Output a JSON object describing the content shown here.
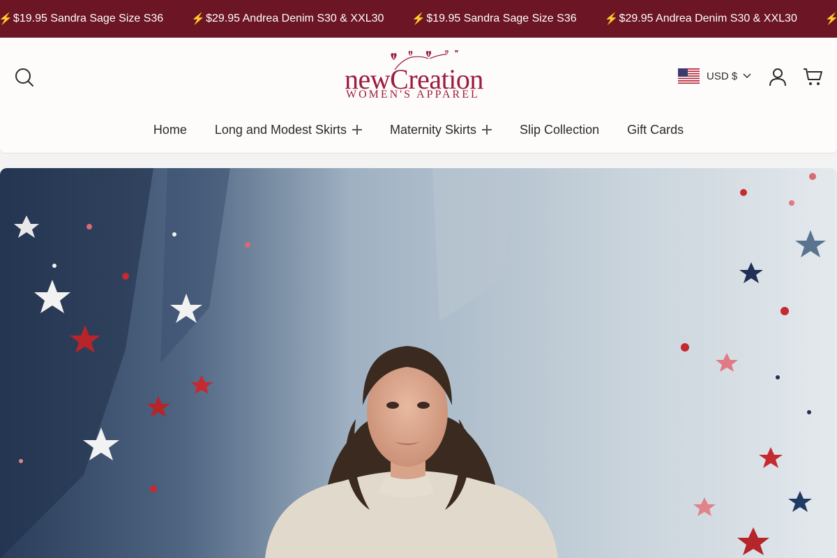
{
  "announcement": {
    "items": [
      "$19.95 Sandra Sage Size S36",
      "$29.95 Andrea Denim S30 & XXL30",
      "$19.95 Sandra Sage Size S36",
      "$29.95 Andrea Denim S30 & XXL30",
      "$"
    ],
    "bolt": "⚡"
  },
  "header": {
    "logo": {
      "main": "newCreation",
      "sub": "WOMEN'S APPAREL"
    },
    "currency": "USD $"
  },
  "nav": {
    "items": [
      {
        "label": "Home"
      },
      {
        "label": "Long and Modest Skirts"
      },
      {
        "label": "Maternity Skirts"
      },
      {
        "label": "Slip Collection"
      },
      {
        "label": "Gift Cards"
      }
    ]
  },
  "colors": {
    "announcement_bg": "#6b1525",
    "brand": "#9c1b3e",
    "header_bg": "#fdfcfb"
  },
  "icons": [
    "search-icon",
    "us-flag-icon",
    "chevron-down-icon",
    "account-icon",
    "cart-icon",
    "plus-icon",
    "lightning-icon"
  ]
}
